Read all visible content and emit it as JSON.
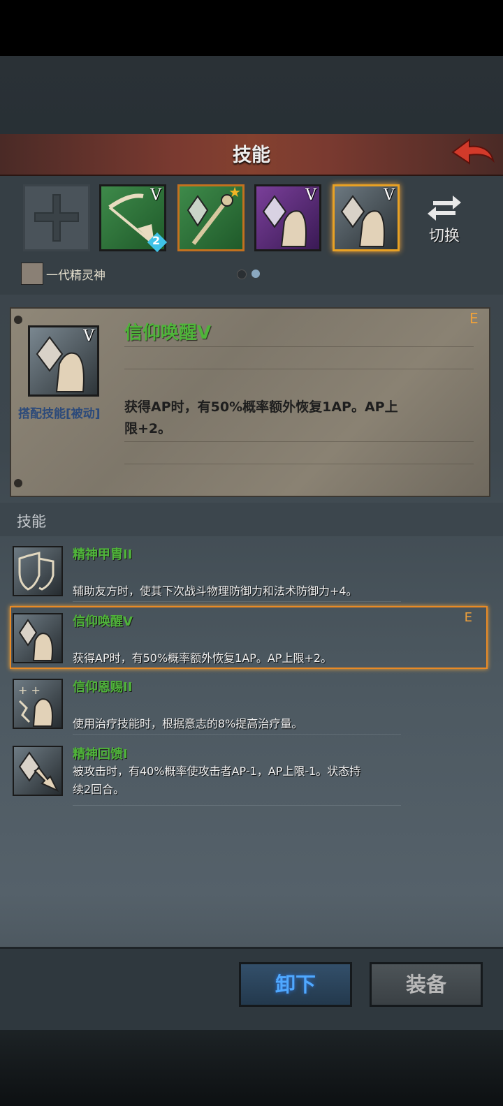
{
  "header": {
    "title": "技能"
  },
  "slots": {
    "items": [
      {
        "rank": "V",
        "badge": "2",
        "color": "#2f7a3c"
      },
      {
        "rank": "",
        "star": true,
        "color": "#2f7a3c"
      },
      {
        "rank": "V",
        "color": "#5e2e7a"
      },
      {
        "rank": "V",
        "color": "#4c565c",
        "selected": true
      }
    ],
    "switch_label": "切换",
    "character_name": "一代精灵神",
    "page_indicator": {
      "pages": 2,
      "current": 2
    }
  },
  "detail": {
    "name": "信仰唤醒V",
    "rank_letter": "E",
    "type_label": "搭配技能[被动]",
    "description_line1": "获得AP时，有50%概率额外恢复1AP。AP上",
    "description_line2": "限+2。"
  },
  "skills_section": {
    "label": "技能",
    "items": [
      {
        "name": "精神甲胄II",
        "description": "辅助友方时，使其下次战斗物理防御力和法术防御力+4。",
        "icon": "mind-armor-icon"
      },
      {
        "name": "信仰唤醒V",
        "description": "获得AP时，有50%概率额外恢复1AP。AP上限+2。",
        "icon": "faith-awaken-icon",
        "rank_letter": "E",
        "selected": true
      },
      {
        "name": "信仰恩赐II",
        "description": "使用治疗技能时，根据意志的8%提高治疗量。",
        "icon": "faith-gift-icon"
      },
      {
        "name": "精神回馈I",
        "description_line1": "被攻击时，有40%概率使攻击者AP-1，AP上限-1。状态持",
        "description_line2": "续2回合。",
        "icon": "mind-feedback-icon"
      }
    ]
  },
  "buttons": {
    "unequip": "卸下",
    "equip": "装备"
  }
}
